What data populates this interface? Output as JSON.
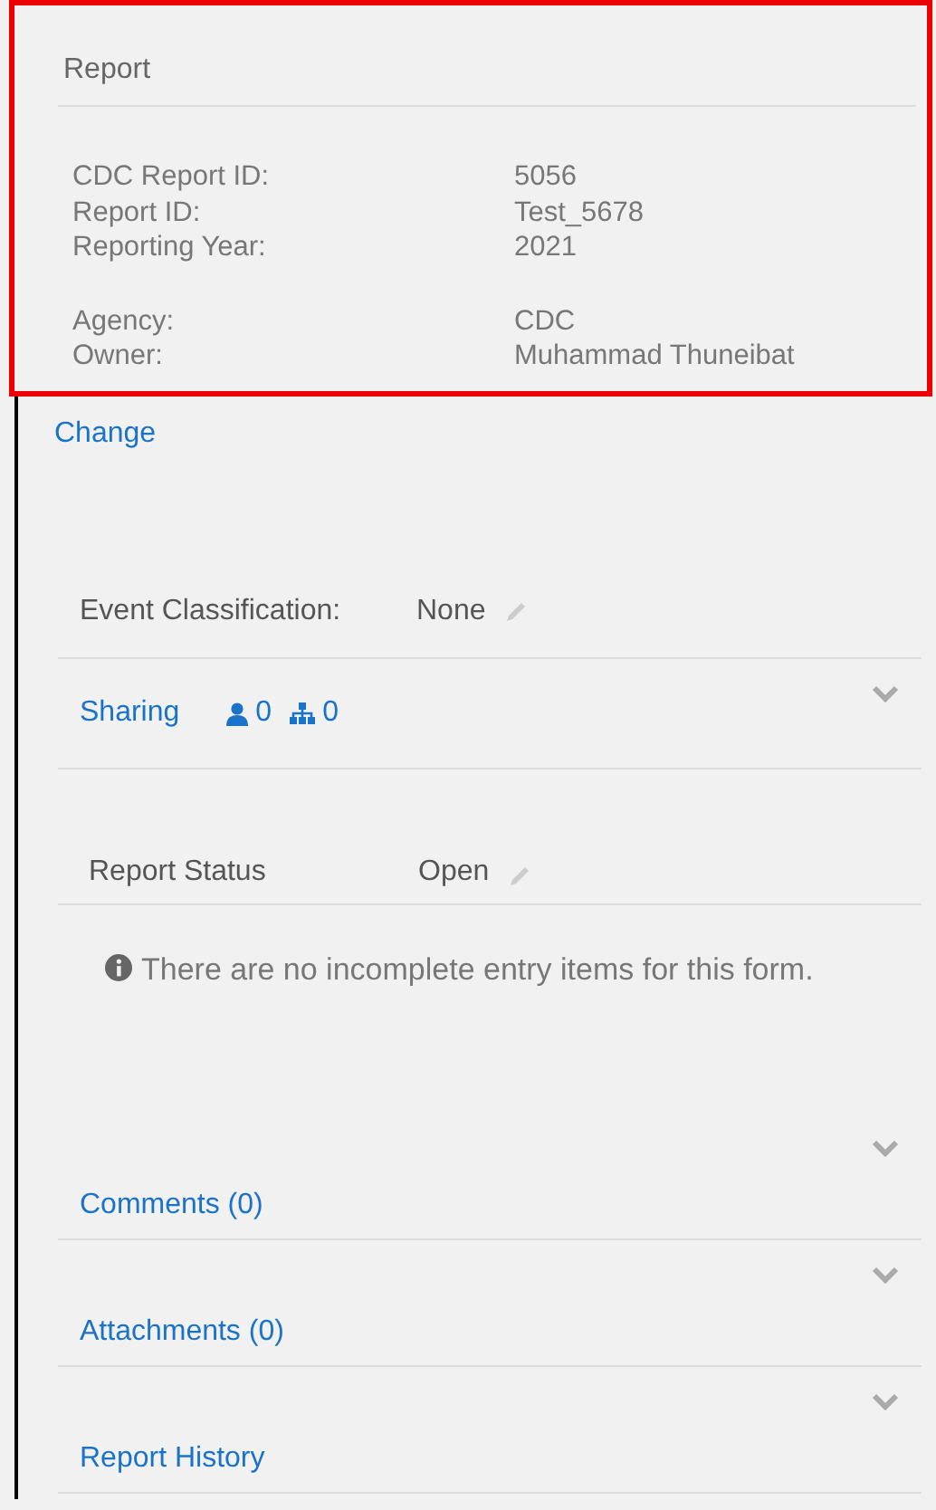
{
  "report": {
    "title": "Report",
    "groups": [
      [
        {
          "label": "CDC Report ID:",
          "value": "5056"
        },
        {
          "label": "Report ID:",
          "value": "Test_5678"
        },
        {
          "label": "Reporting Year:",
          "value": "2021"
        }
      ],
      [
        {
          "label": "Agency:",
          "value": "CDC"
        },
        {
          "label": "Owner:",
          "value": "Muhammad Thuneibat"
        }
      ]
    ]
  },
  "change_link": "Change",
  "event_classification": {
    "label": "Event Classification:",
    "value": "None"
  },
  "sharing": {
    "label": "Sharing",
    "users": "0",
    "groups": "0"
  },
  "report_status": {
    "label": "Report Status",
    "value": "Open"
  },
  "info_message": "There are no incomplete entry items for this form.",
  "sections": [
    {
      "label": "Comments (0)"
    },
    {
      "label": "Attachments (0)"
    },
    {
      "label": "Report History"
    }
  ]
}
